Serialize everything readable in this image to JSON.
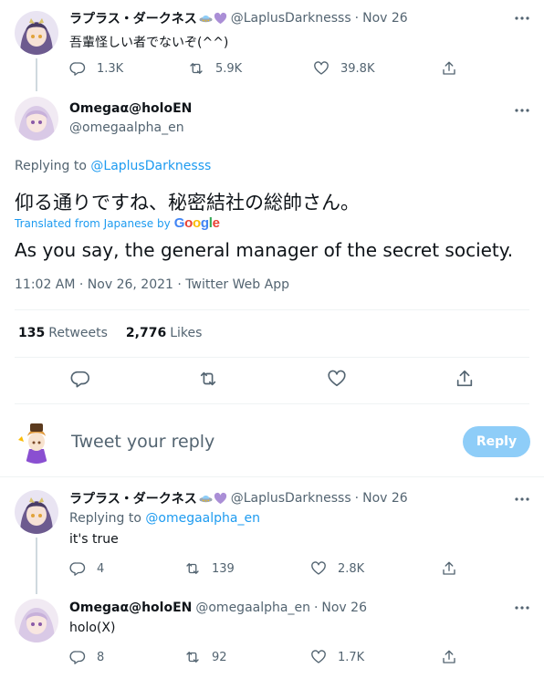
{
  "tweet1": {
    "name": "ラプラス・ダークネス",
    "handle": "@LaplusDarknesss",
    "sep": "·",
    "date": "Nov 26",
    "text": "吾輩怪しい者でないぞ(^^)",
    "replies": "1.3K",
    "retweets": "5.9K",
    "likes": "39.8K"
  },
  "main": {
    "name": "Omegaα@holoEN",
    "handle": "@omegaalpha_en",
    "replying_prefix": "Replying to ",
    "replying_to": "@LaplusDarknesss",
    "text": "仰る通りですね、秘密結社の総帥さん。",
    "translated_label": "Translated from Japanese by",
    "google": [
      "G",
      "o",
      "o",
      "g",
      "l",
      "e"
    ],
    "translation": "As you say, the general manager of the secret society.",
    "timestamp": "11:02 AM · Nov 26, 2021 · Twitter Web App",
    "retweets_count": "135",
    "retweets_label": "Retweets",
    "likes_count": "2,776",
    "likes_label": "Likes"
  },
  "compose": {
    "placeholder": "Tweet your reply",
    "button": "Reply"
  },
  "reply1": {
    "name": "ラプラス・ダークネス",
    "handle": "@LaplusDarknesss",
    "sep": "·",
    "date": "Nov 26",
    "replying_prefix": "Replying to ",
    "replying_to": "@omegaalpha_en",
    "text": "it's true",
    "replies": "4",
    "retweets": "139",
    "likes": "2.8K"
  },
  "reply2": {
    "name": "Omegaα@holoEN",
    "handle": "@omegaalpha_en",
    "sep": "·",
    "date": "Nov 26",
    "text": "holo(X)",
    "replies": "8",
    "retweets": "92",
    "likes": "1.7K"
  },
  "colors": {
    "accent": "#1d9bf0",
    "muted": "#536471",
    "reply_button_disabled": "#8ecdf8",
    "google": [
      "#4285F4",
      "#EA4335",
      "#FBBC05",
      "#4285F4",
      "#34A853",
      "#EA4335"
    ]
  }
}
